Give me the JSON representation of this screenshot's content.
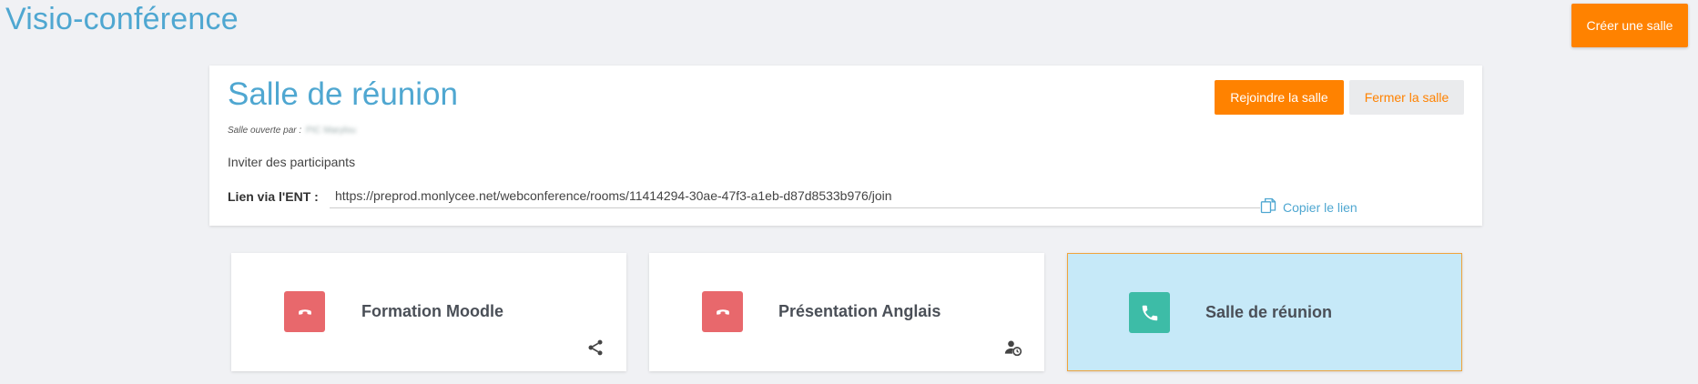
{
  "header": {
    "title": "Visio-conférence",
    "create_room_label": "Créer une salle"
  },
  "current_room": {
    "title": "Salle de réunion",
    "opened_by_label": "Salle ouverte par :",
    "opened_by_name": "PIC Marylou",
    "invite_label": "Inviter des participants",
    "link_label": "Lien via l'ENT :",
    "link_value": "https://preprod.monlycee.net/webconference/rooms/11414294-30ae-47f3-a1eb-d87d8533b976/join",
    "copy_label": "Copier le lien",
    "join_label": "Rejoindre la salle",
    "close_label": "Fermer la salle"
  },
  "rooms": [
    {
      "name": "Formation Moodle",
      "status": "closed",
      "action_icon": "share-icon"
    },
    {
      "name": "Présentation Anglais",
      "status": "closed",
      "action_icon": "user-clock-icon"
    },
    {
      "name": "Salle de réunion",
      "status": "open",
      "action_icon": ""
    }
  ],
  "colors": {
    "accent_blue": "#4fa7d1",
    "orange": "#ff8200",
    "closed_red": "#e8686c",
    "open_green": "#3dbca7",
    "active_card_bg": "#c6e9f8"
  }
}
